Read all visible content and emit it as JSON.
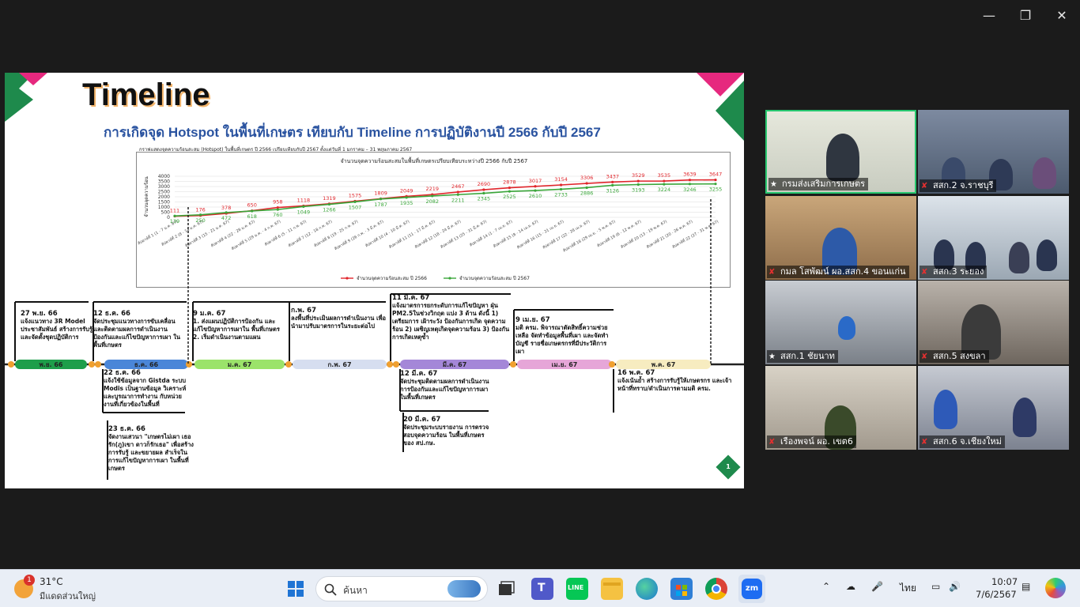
{
  "slide": {
    "title": "Timeline",
    "subtitle": "การเกิดจุด Hotspot ในพื้นที่เกษตร เทียบกับ Timeline การปฏิบัติงานปี 2566 กับปี 2567",
    "chart_caption": "กราฟแสดงจุดความร้อนสะสม (Hotspot) ในพื้นที่เกษตร ปี 2566 เปรียบเทียบกับปี 2567 ตั้งแต่วันที่ 1 มกราคม – 31 พฤษภาคม 2567",
    "page_number": "1"
  },
  "chart_data": {
    "type": "line",
    "title": "จำนวนจุดความร้อนสะสมในพื้นที่เกษตรเปรียบเทียบระหว่างปี 2566 กับปี 2567",
    "ylabel": "จำนวนจุดความร้อน",
    "ylim": [
      0,
      4000
    ],
    "yticks": [
      "4000",
      "3500",
      "3000",
      "2500",
      "2000",
      "1500",
      "1000",
      "500",
      "0"
    ],
    "categories": [
      "สัปดาห์ที่ 1 (1 - 7 ม.ค. 67)",
      "สัปดาห์ที่ 2 (8 - 14 ม.ค. 67)",
      "สัปดาห์ที่ 3 (15 - 21 ม.ค. 67)",
      "สัปดาห์ที่ 4 (22 - 28 ม.ค. 67)",
      "สัปดาห์ที่ 5 (29 ม.ค. - 4 ก.พ. 67)",
      "สัปดาห์ที่ 6 (5 - 11 ก.พ. 67)",
      "สัปดาห์ที่ 7 (12 - 18 ก.พ. 67)",
      "สัปดาห์ที่ 8 (19 - 25 ก.พ. 67)",
      "สัปดาห์ที่ 9 (26 ก.พ. - 3 มี.ค. 67)",
      "สัปดาห์ที่ 10 (4 - 10 มี.ค. 67)",
      "สัปดาห์ที่ 11 (11 - 17 มี.ค. 67)",
      "สัปดาห์ที่ 12 (18 - 24 มี.ค. 67)",
      "สัปดาห์ที่ 13 (25 - 31 มี.ค. 67)",
      "สัปดาห์ที่ 14 (1 - 7 เม.ย. 67)",
      "สัปดาห์ที่ 15 (8 - 14 เม.ย. 67)",
      "สัปดาห์ที่ 16 (15 - 21 เม.ย. 67)",
      "สัปดาห์ที่ 17 (22 - 28 เม.ย. 67)",
      "สัปดาห์ที่ 18 (29 เม.ย. - 5 พ.ค. 67)",
      "สัปดาห์ที่ 19 (6 - 12 พ.ค. 67)",
      "สัปดาห์ที่ 20 (13 - 19 พ.ค. 67)",
      "สัปดาห์ที่ 21 (20 - 26 พ.ค. 67)",
      "สัปดาห์ที่ 22 (27 - 31 พ.ค. 67)"
    ],
    "series": [
      {
        "name": "จำนวนจุดความร้อนสะสม ปี 2566",
        "color": "#e0252b",
        "values": [
          111,
          176,
          378,
          650,
          958,
          1118,
          1319,
          1575,
          1809,
          2049,
          2219,
          2467,
          2690,
          2878,
          3017,
          3154,
          3306,
          3437,
          3529,
          3535,
          3639,
          3647
        ]
      },
      {
        "name": "จำนวนจุดความร้อนสะสม ปี 2567",
        "color": "#3aa63a",
        "values": [
          139,
          250,
          472,
          618,
          760,
          1049,
          1266,
          1507,
          1787,
          1935,
          2082,
          2211,
          2345,
          2525,
          2610,
          2733,
          2886,
          3126,
          3193,
          3224,
          3246,
          3255
        ]
      }
    ],
    "legend": "bottom",
    "grid": true
  },
  "timeline": {
    "months": [
      {
        "label": "พ.ย. 66",
        "color": "#1e9e4a"
      },
      {
        "label": "ธ.ค. 66",
        "color": "#4a86d8"
      },
      {
        "label": "ม.ค. 67",
        "color": "#9be36a"
      },
      {
        "label": "ก.พ. 67",
        "color": "#d6def0"
      },
      {
        "label": "มี.ค. 67",
        "color": "#a487d8"
      },
      {
        "label": "เม.ย. 67",
        "color": "#e6a6d8"
      },
      {
        "label": "พ.ค. 67",
        "color": "#f7ecc0"
      }
    ],
    "events": [
      {
        "date": "27 พ.ย. 66",
        "text": "แจ้งแนวทาง 3R Model ประชาสัมพันธ์ สร้างการรับรู้ และจัดตั้งชุดปฏิบัติการ"
      },
      {
        "date": "12 ธ.ค. 66",
        "text": "จัดประชุมแนวทางการขับเคลื่อน และติดตามผลการดำเนินงาน ป้องกันและแก้ไขปัญหาการเผา ในพื้นที่เกษตร"
      },
      {
        "date": "22 ธ.ค. 66",
        "text": "แจ้งใช้ข้อมูลจาก Gistda ระบบ Modis เป็นฐานข้อมูล วิเคราะห์ และบูรณาการทำงาน กับหน่วยงานที่เกี่ยวข้องในพื้นที่"
      },
      {
        "date": "23 ธ.ค. 66",
        "text": "จัดงานเสวนา \"เกษตรไม่เผา เธอรัก(ภู)เขา ดาวก็รักเธอ\" เพื่อสร้างการรับรู้ และขยายผล สำเร็จในการแก้ไขปัญหาการเผา ในพื้นที่เกษตร"
      },
      {
        "date": "9 ม.ค. 67",
        "text": "1. ส่งแผนปฏิบัติการป้องกัน และแก้ไขปัญหาการเผาใน พื้นที่เกษตร 2. เริ่มดำเนินงานตามแผน"
      },
      {
        "date": "ก.พ. 67",
        "text": "ลงพื้นที่ประเมินผลการดำเนินงาน เพื่อนำมาปรับมาตรการในระยะต่อไป"
      },
      {
        "date": "11 มี.ค. 67",
        "text": "แจ้งมาตรการยกระดับการแก้ไขปัญหา ฝุ่น PM2.5ในช่วงวิกฤต แบ่ง 3 ด้าน ดังนี้ 1) เตรียมการ เฝ้าระวัง ป้องกันการเกิด จุดความร้อน 2) เผชิญเหตุเกิดจุดความร้อน 3) ป้องกันการเกิดเหตุซ้ำ"
      },
      {
        "date": "12 มี.ค. 67",
        "text": "จัดประชุมติดตามผลการดำเนินงาน การป้องกันและแก้ไขปัญหาการเผา ในพื้นที่เกษตร"
      },
      {
        "date": "20 มี.ค. 67",
        "text": "จัดประชุมระบบรายงาน การตรวจสอบจุดความร้อน ในพื้นที่เกษตรของ สป.กษ."
      },
      {
        "date": "9 เม.ย. 67",
        "text": "มติ ครม. พิจารณาตัดสิทธิ์ความช่วยเหลือ จัดทำข้อมูลพื้นที่เผา และจัดทำบัญชี รายชื่อเกษตรกรที่มีประวัติการเผา"
      },
      {
        "date": "16 พ.ค. 67",
        "text": "แจ้งเน้นย้ำ สร้างการรับรู้ให้เกษตรกร และเจ้าหน้าที่ทราบ/ดำเนินการตามมติ ครม."
      }
    ]
  },
  "participants": [
    {
      "name": "กรมส่งเสริมการเกษตร",
      "muted": false,
      "active": true
    },
    {
      "name": "สสก.2 จ.ราชบุรี",
      "muted": true,
      "active": false
    },
    {
      "name": "กมล โสพัฒน์ ผอ.สสก.4 ขอนแก่น",
      "muted": true,
      "active": false
    },
    {
      "name": "สสก.3 ระยอง",
      "muted": true,
      "active": false
    },
    {
      "name": "สสก.1 ชัยนาท",
      "muted": false,
      "active": false
    },
    {
      "name": "สสก.5 สงขลา",
      "muted": true,
      "active": false
    },
    {
      "name": "เรืองพจน์ ผอ. เขต6",
      "muted": true,
      "active": false
    },
    {
      "name": "สสก.6 จ.เชียงใหม่",
      "muted": true,
      "active": false
    }
  ],
  "taskbar": {
    "weather_temp": "31°C",
    "weather_desc": "มีแดดส่วนใหญ่",
    "weather_badge": "1",
    "search_placeholder": "ค้นหา",
    "language": "ไทย",
    "time": "10:07",
    "date": "7/6/2567",
    "apps": [
      "windows-start",
      "search",
      "task-view",
      "teams",
      "line",
      "file-explorer",
      "edge",
      "microsoft-store",
      "chrome",
      "zoom"
    ]
  }
}
